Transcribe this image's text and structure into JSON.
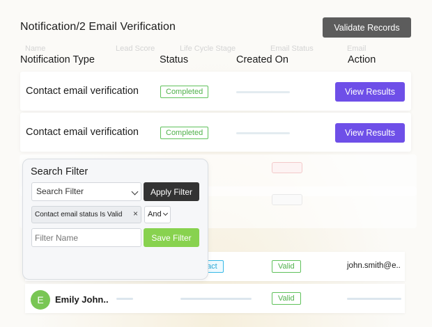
{
  "header": {
    "title": "Notification/2 Email Verification",
    "validate_label": "Validate Records"
  },
  "background_table": {
    "columns": [
      "Name",
      "Lead Score",
      "Life Cycle Stage",
      "Email Status",
      "Email"
    ]
  },
  "notifications": {
    "columns": [
      "Notification Type",
      "Status",
      "Created On",
      "Action"
    ],
    "rows": [
      {
        "type": "Contact email verification",
        "status": "Completed",
        "action": "View Results"
      },
      {
        "type": "Contact email verification",
        "status": "Completed",
        "action": "View Results"
      }
    ]
  },
  "contacts": [
    {
      "lifecycle": "act",
      "status": "Valid",
      "email": "john.smith@e.."
    },
    {
      "initial": "E",
      "name": "Emily John..",
      "status": "Valid"
    }
  ],
  "filter": {
    "title": "Search Filter",
    "select_value": "Search Filter",
    "apply_label": "Apply Filter",
    "chip_label": "Contact email status Is Valid",
    "chip_close": "×",
    "operator": "And",
    "name_placeholder": "Filter Name",
    "save_label": "Save Filter"
  },
  "colors": {
    "primary": "#6e4fe8",
    "success": "#5fc15a",
    "dark_button": "#5c5c5c",
    "save_button": "#88d24f"
  }
}
